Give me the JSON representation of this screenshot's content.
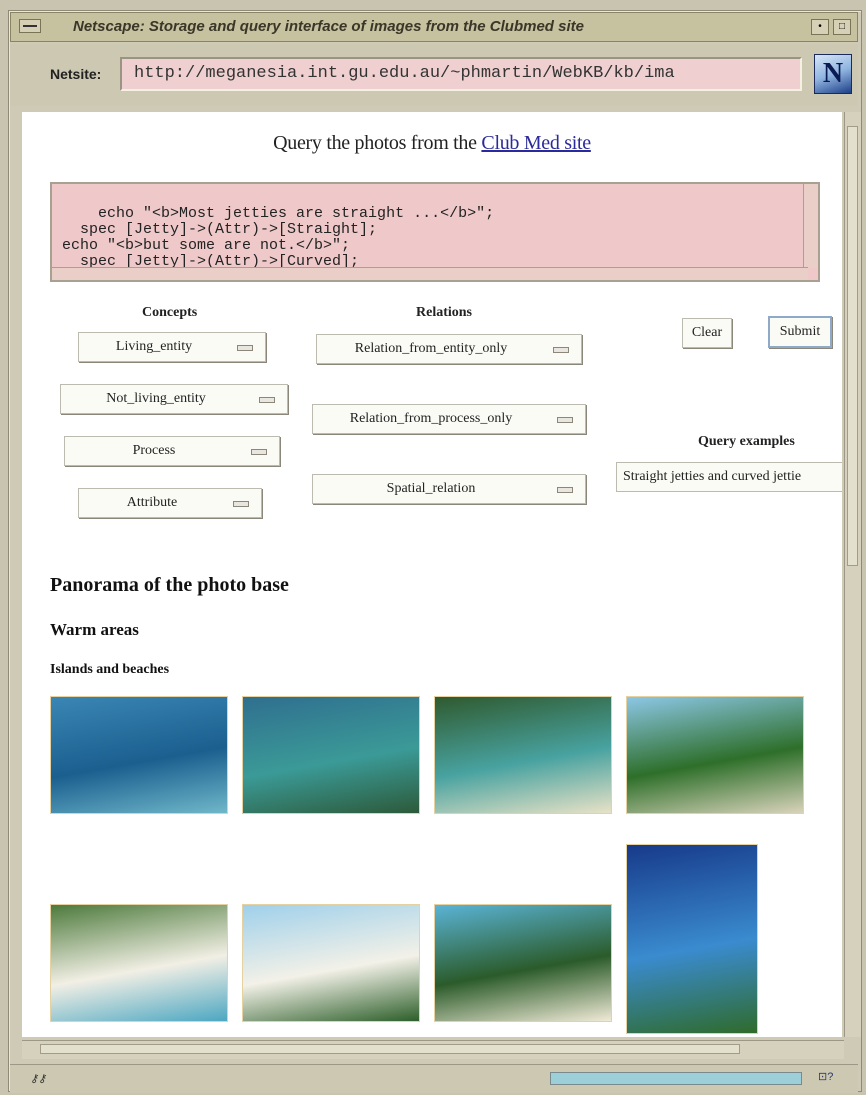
{
  "window": {
    "title": "Netscape: Storage and query interface of images from the Clubmed site"
  },
  "location": {
    "label": "Netsite:",
    "url": "http://meganesia.int.gu.edu.au/~phmartin/WebKB/kb/ima",
    "logo": "N"
  },
  "page": {
    "heading_prefix": "Query the photos from the",
    "heading_link": "Club Med site",
    "query_text": "echo \"<b>Most jetties are straight ...</b>\";\n  spec [Jetty]->(Attr)->[Straight];\necho \"<b>but some are not.</b>\";\n  spec [Jetty]->(Attr)->[Curved];",
    "concepts_label": "Concepts",
    "concepts": [
      "Living_entity",
      "Not_living_entity",
      "Process",
      "Attribute"
    ],
    "relations_label": "Relations",
    "relations": [
      "Relation_from_entity_only",
      "Relation_from_process_only",
      "Spatial_relation"
    ],
    "clear_label": "Clear",
    "submit_label": "Submit",
    "query_examples_label": "Query examples",
    "query_example_value": "Straight jetties and curved jettie",
    "section_title": "Panorama of the photo base",
    "subsection_title": "Warm areas",
    "subsubsection_title": "Islands and beaches"
  },
  "status": {
    "left_icon": "security-key-icon",
    "mail_icon": "mail-icon",
    "mail_text": "⊡?"
  },
  "photos": [
    {
      "name": "islands-aerial",
      "colors": [
        "#3a86b4",
        "#1b5f8f",
        "#6fb7c9"
      ]
    },
    {
      "name": "lagoon-island",
      "colors": [
        "#2f6f8f",
        "#3b9a97",
        "#2c5a3a"
      ]
    },
    {
      "name": "beach-forest",
      "colors": [
        "#2f5a2f",
        "#48a2a0",
        "#e8e2c6"
      ]
    },
    {
      "name": "jetty-resort",
      "colors": [
        "#8cc7e6",
        "#2e6f2a",
        "#d9d3bb"
      ]
    },
    {
      "name": "beach-coast",
      "colors": [
        "#4d7a3c",
        "#f2efe5",
        "#4ca7c2"
      ]
    },
    {
      "name": "palms-beach",
      "colors": [
        "#9fd0ea",
        "#f3f1e8",
        "#2d5f2a"
      ]
    },
    {
      "name": "palm-lagoon",
      "colors": [
        "#5ab4d6",
        "#2b5b2a",
        "#f0ead6"
      ]
    },
    {
      "name": "palm-pier",
      "colors": [
        "#173a8a",
        "#3a8bcf",
        "#2f6b2c"
      ]
    }
  ]
}
